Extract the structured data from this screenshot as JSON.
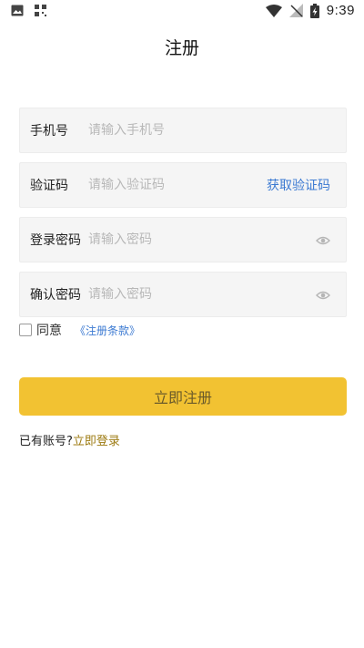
{
  "status_bar": {
    "time": "9:39"
  },
  "page": {
    "title": "注册"
  },
  "form": {
    "phone": {
      "label": "手机号",
      "placeholder": "请输入手机号"
    },
    "code": {
      "label": "验证码",
      "placeholder": "请输入验证码",
      "action": "获取验证码"
    },
    "password": {
      "label": "登录密码",
      "placeholder": "请输入密码"
    },
    "confirm": {
      "label": "确认密码",
      "placeholder": "请输入密码"
    }
  },
  "agreement": {
    "checked": false,
    "text": "同意",
    "terms_link": "《注册条款》"
  },
  "register_button": "立即注册",
  "login": {
    "prompt": "已有账号?",
    "link": "立即登录"
  },
  "colors": {
    "accent": "#f2c232",
    "link_blue": "#3c7ad2",
    "login_link": "#9c7a10"
  }
}
